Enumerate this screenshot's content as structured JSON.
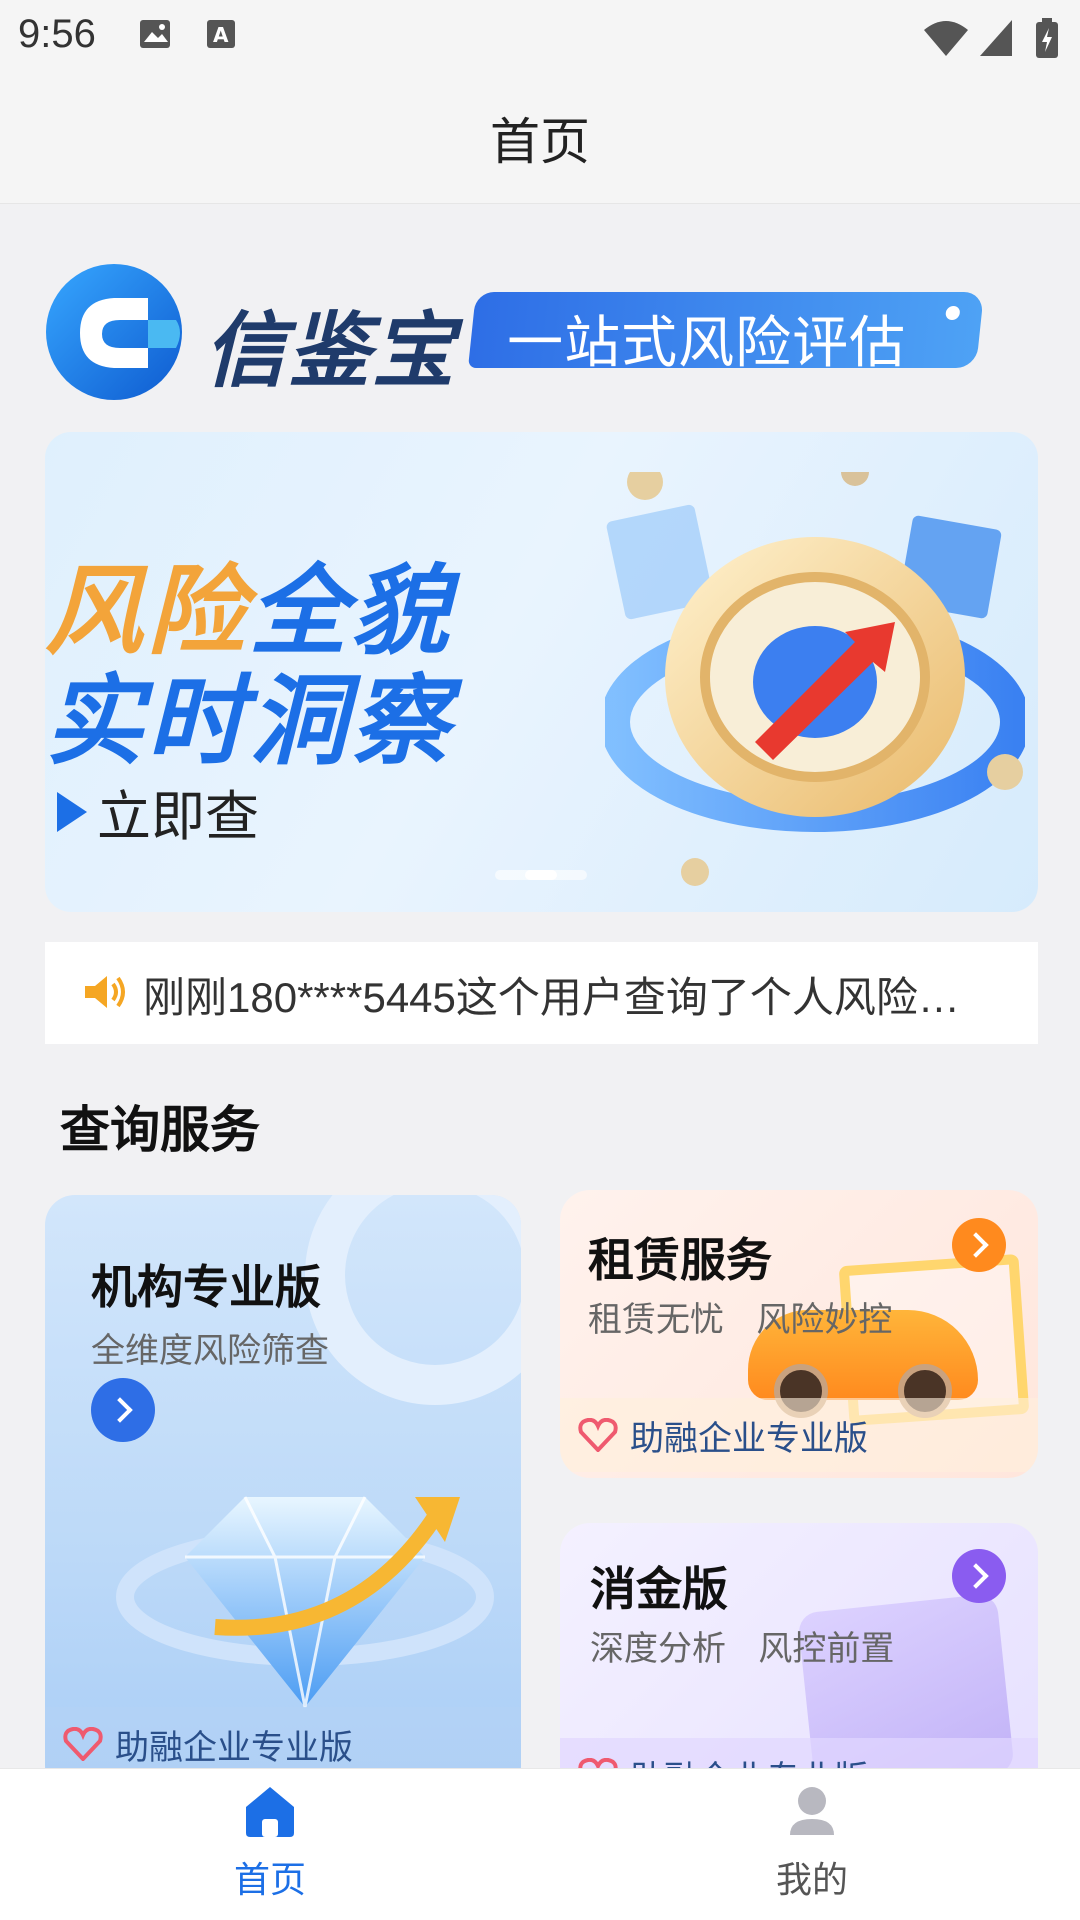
{
  "status_bar": {
    "time": "9:56"
  },
  "header": {
    "title": "首页"
  },
  "brand": {
    "name": "信鉴宝",
    "slogan": "一站式风险评估"
  },
  "banner": {
    "line1_part1": "风险",
    "line1_part2": "全貌",
    "line2": "实时洞察",
    "cta": "立即查"
  },
  "notice": {
    "text": "刚刚180****5445这个用户查询了个人风险…"
  },
  "section": {
    "title": "查询服务"
  },
  "cards": {
    "institution": {
      "title": "机构专业版",
      "subtitle": "全维度风险筛查",
      "footer": "助融企业专业版"
    },
    "rental": {
      "title": "租赁服务",
      "subtitle": "租赁无忧   风险妙控",
      "footer": "助融企业专业版"
    },
    "consumer": {
      "title": "消金版",
      "subtitle": "深度分析   风控前置",
      "footer": "助融企业专业版"
    }
  },
  "bottom_nav": {
    "home": "首页",
    "mine": "我的"
  },
  "colors": {
    "primary": "#1c6fe6",
    "accent_orange": "#f3a43a",
    "rental_arrow": "#ff8a1e",
    "consumer_arrow": "#8a5cf0"
  }
}
